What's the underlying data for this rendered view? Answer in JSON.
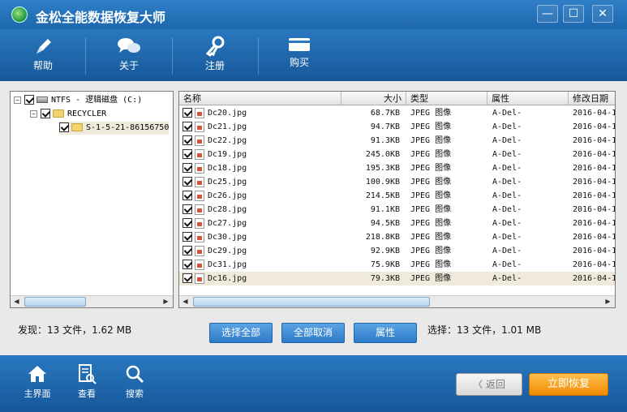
{
  "window": {
    "title": "金松全能数据恢复大师",
    "minimize_glyph": "—",
    "maximize_glyph": "☐",
    "close_glyph": "✕"
  },
  "toolbar": {
    "help_label": "帮助",
    "about_label": "关于",
    "register_label": "注册",
    "buy_label": "购买"
  },
  "tree": {
    "drive_label": "NTFS - 逻辑磁盘 (C:)",
    "recycler_label": "RECYCLER",
    "sid_label": "S-1-5-21-86156750"
  },
  "file_list": {
    "columns": [
      "名称",
      "大小",
      "类型",
      "属性",
      "修改日期"
    ],
    "rows": [
      {
        "name": "Dc20.jpg",
        "size": "68.7KB",
        "type": "JPEG 图像",
        "attr": "A-Del-",
        "date": "2016-04-1"
      },
      {
        "name": "Dc21.jpg",
        "size": "94.7KB",
        "type": "JPEG 图像",
        "attr": "A-Del-",
        "date": "2016-04-1"
      },
      {
        "name": "Dc22.jpg",
        "size": "91.3KB",
        "type": "JPEG 图像",
        "attr": "A-Del-",
        "date": "2016-04-1"
      },
      {
        "name": "Dc19.jpg",
        "size": "245.0KB",
        "type": "JPEG 图像",
        "attr": "A-Del-",
        "date": "2016-04-1"
      },
      {
        "name": "Dc18.jpg",
        "size": "195.3KB",
        "type": "JPEG 图像",
        "attr": "A-Del-",
        "date": "2016-04-1"
      },
      {
        "name": "Dc25.jpg",
        "size": "100.9KB",
        "type": "JPEG 图像",
        "attr": "A-Del-",
        "date": "2016-04-1"
      },
      {
        "name": "Dc26.jpg",
        "size": "214.5KB",
        "type": "JPEG 图像",
        "attr": "A-Del-",
        "date": "2016-04-1"
      },
      {
        "name": "Dc28.jpg",
        "size": "91.1KB",
        "type": "JPEG 图像",
        "attr": "A-Del-",
        "date": "2016-04-1"
      },
      {
        "name": "Dc27.jpg",
        "size": "94.5KB",
        "type": "JPEG 图像",
        "attr": "A-Del-",
        "date": "2016-04-1"
      },
      {
        "name": "Dc30.jpg",
        "size": "218.8KB",
        "type": "JPEG 图像",
        "attr": "A-Del-",
        "date": "2016-04-1"
      },
      {
        "name": "Dc29.jpg",
        "size": "92.9KB",
        "type": "JPEG 图像",
        "attr": "A-Del-",
        "date": "2016-04-1"
      },
      {
        "name": "Dc31.jpg",
        "size": "75.9KB",
        "type": "JPEG 图像",
        "attr": "A-Del-",
        "date": "2016-04-1"
      },
      {
        "name": "Dc16.jpg",
        "size": "79.3KB",
        "type": "JPEG 图像",
        "attr": "A-Del-",
        "date": "2016-04-1"
      }
    ]
  },
  "status": {
    "found": "发现：13 文件，1.62 MB",
    "selected": "选择：13 文件，1.01 MB"
  },
  "actions": {
    "select_all": "选择全部",
    "deselect_all": "全部取消",
    "properties": "属性"
  },
  "bottom_nav": {
    "home_label": "主界面",
    "view_label": "查看",
    "search_label": "搜索",
    "back_label": "返回",
    "recover_label": "立即恢复"
  },
  "colors": {
    "titlebar": "#1d67ad",
    "toolbar": "#17589a",
    "content_bg": "#e9e9e9",
    "action_button": "#2c7ac9",
    "recover_button": "#f08a00"
  }
}
